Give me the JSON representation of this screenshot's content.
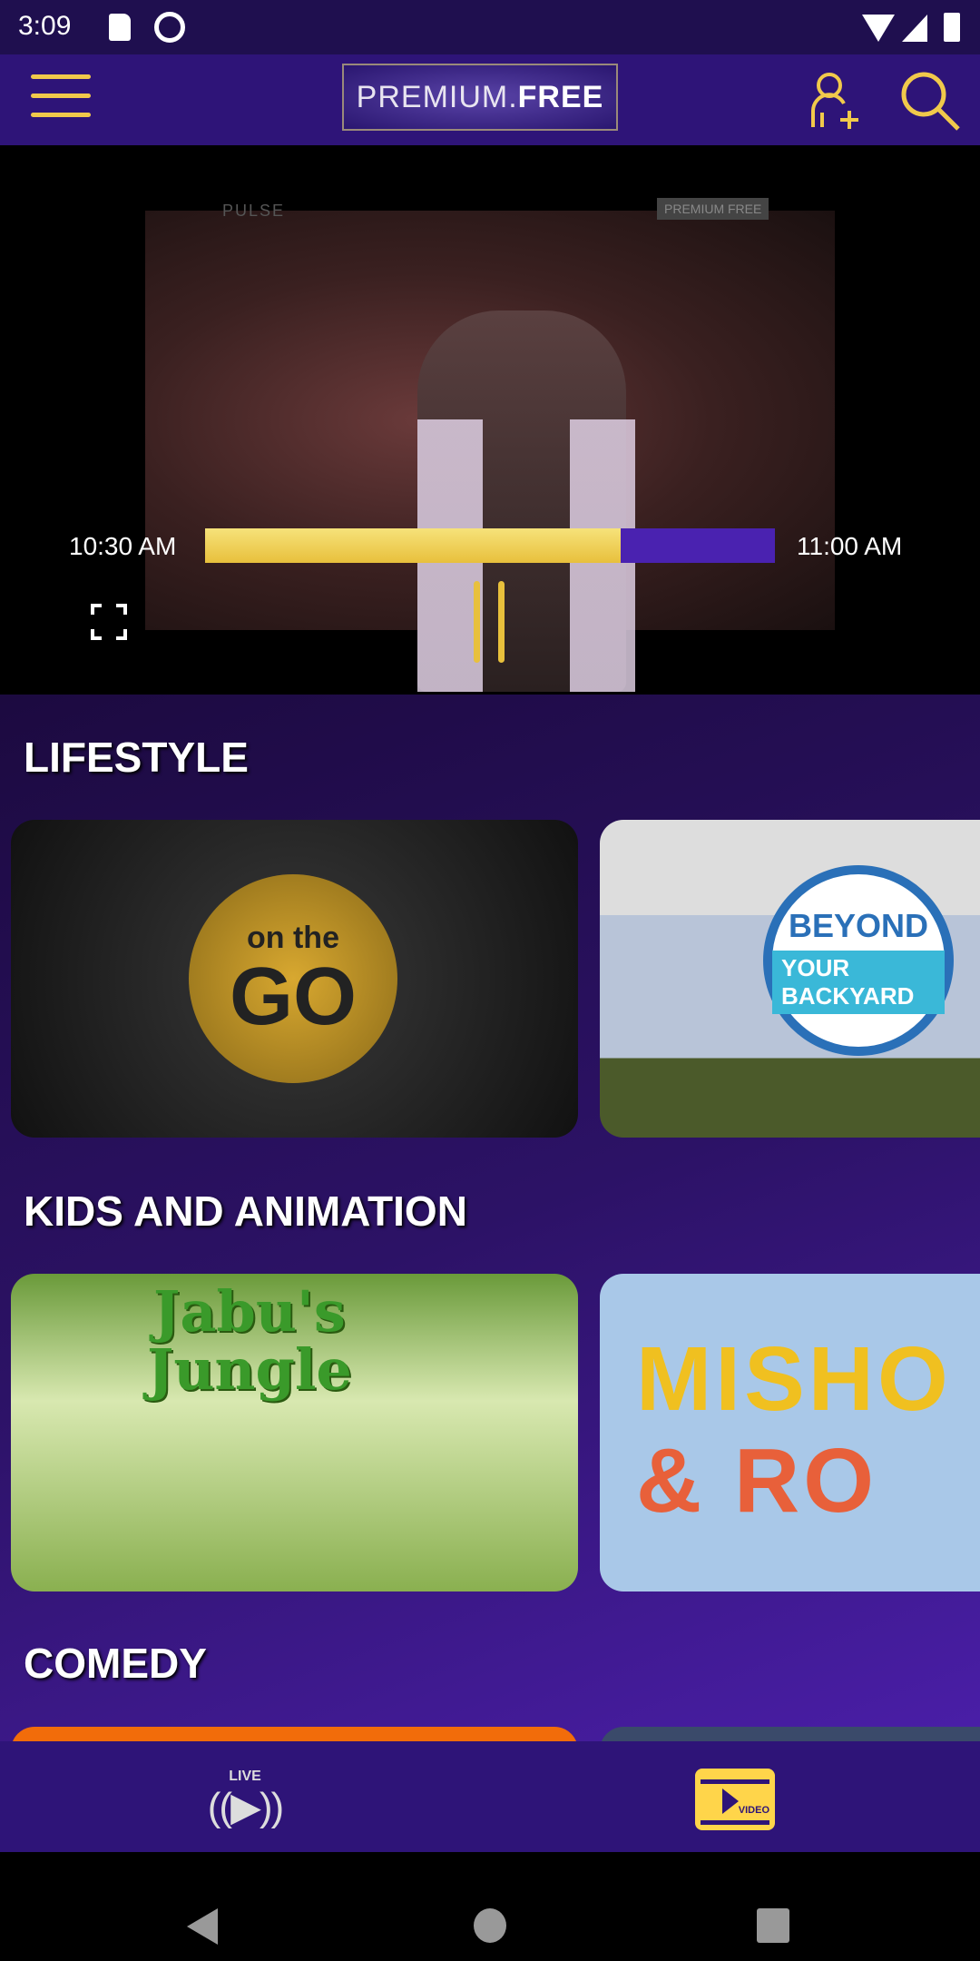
{
  "status_bar": {
    "time": "3:09",
    "icons": [
      "sd-card-icon",
      "data-saver-icon",
      "wifi-icon",
      "signal-icon",
      "battery-icon"
    ]
  },
  "header": {
    "logo_light": "PREMIUM.",
    "logo_bold": "FREE",
    "icons": [
      "menu-icon",
      "add-user-icon",
      "search-icon"
    ]
  },
  "player": {
    "watermark_left": "PULSE",
    "watermark_right": "PREMIUM FREE",
    "start_time": "10:30 AM",
    "end_time": "11:00 AM",
    "progress": 0.73,
    "state": "playing"
  },
  "sections": [
    {
      "title": "LIFESTYLE",
      "cards": [
        {
          "logo_top": "on the",
          "logo_main": "GO"
        },
        {
          "logo_top": "BEYOND",
          "logo_main": "YOUR BACKYARD"
        }
      ]
    },
    {
      "title": "KIDS AND ANIMATION",
      "cards": [
        {
          "logo_top": "Jabu's",
          "logo_main": "Jungle"
        },
        {
          "logo_top": "MISHO",
          "logo_main": "& RO"
        }
      ]
    },
    {
      "title": "COMEDY"
    }
  ],
  "bottom_nav": {
    "live_label": "LIVE",
    "video_label": "VIDEO",
    "active": "video"
  },
  "colors": {
    "accent": "#f1c94b",
    "header": "#2e1478",
    "progress_bg": "#4a22b0"
  }
}
